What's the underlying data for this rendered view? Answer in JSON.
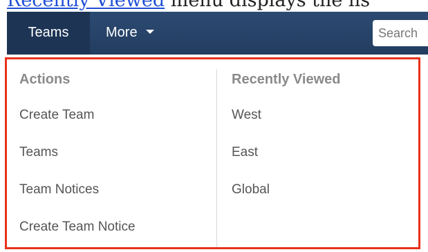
{
  "doc": {
    "link_text": "Recently Viewed",
    "trailing_text": " menu displays the lis"
  },
  "navbar": {
    "tabs": [
      {
        "label": "Teams",
        "active": true
      },
      {
        "label": "More",
        "has_caret": true
      }
    ],
    "search": {
      "placeholder": "Search",
      "value": ""
    }
  },
  "dropdown": {
    "highlight_color": "#e8311a",
    "actions": {
      "title": "Actions",
      "items": [
        "Create Team",
        "Teams",
        "Team Notices",
        "Create Team Notice"
      ]
    },
    "recently_viewed": {
      "title": "Recently Viewed",
      "items": [
        "West",
        "East",
        "Global"
      ]
    }
  },
  "colors": {
    "navbar": "#233d60",
    "active_tab": "#1d3454",
    "menu_text": "#555555",
    "section_title": "#8a8a8a"
  }
}
